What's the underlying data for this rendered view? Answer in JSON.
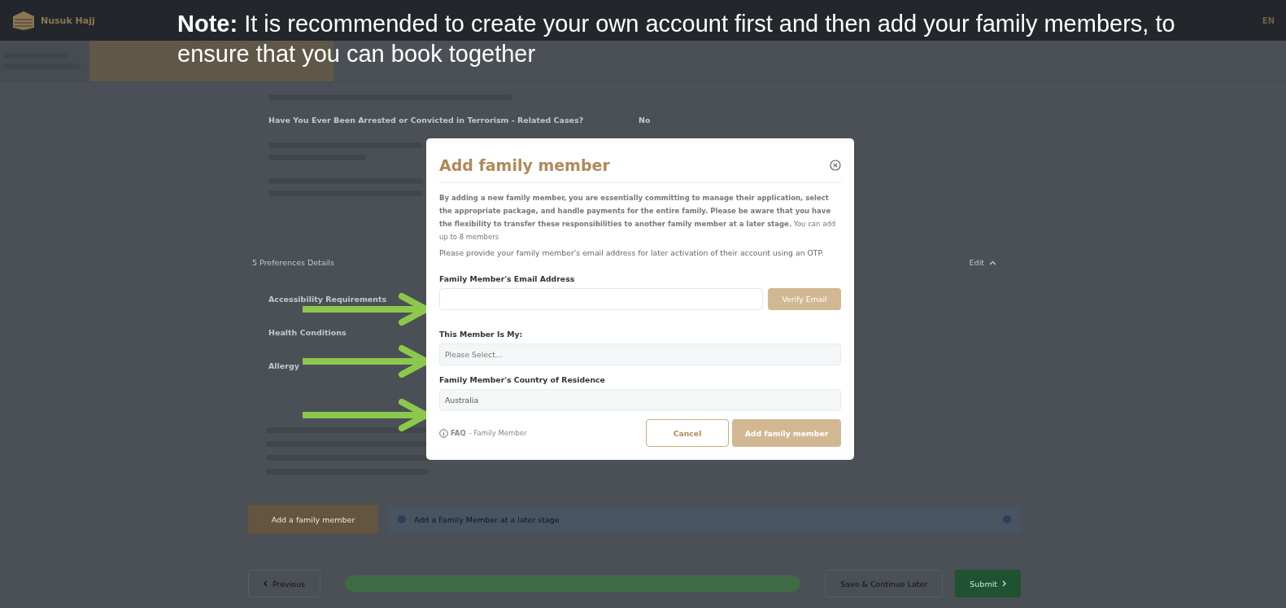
{
  "header": {
    "brand": "Nusuk Hajj",
    "language": "EN"
  },
  "note": "**Note:** It is recommended to create your own account first and then add your family members, to ensure that you can book together",
  "questions": [
    {
      "text": "Have You Ever Been Arrested or Convicted in Terrorism - Related Cases?",
      "answer": "No"
    }
  ],
  "section": {
    "title": "5 Preferences Details",
    "action": "Edit",
    "items": [
      "Accessibility Requirements",
      "Health Conditions",
      "Allergy"
    ]
  },
  "add_member_button": "Add a family member",
  "later_notice": "Add a Family Member at a later stage",
  "footer": {
    "previous": "Previous",
    "save": "Save & Continue Later",
    "submit": "Submit"
  },
  "dialog": {
    "title": "Add family member",
    "intro": "**By adding a new family member, you are essentially committing to manage their application, select the appropriate package, and handle payments for the entire family. Please be aware that you have the flexibility to transfer these responsibilities to another family member at a later stage.** You can add up to 8 members",
    "hint": "Please provide your family member's email address for later activation of their account using an OTP.",
    "email": {
      "label": "Family Member's Email Address",
      "button": "Verify Email"
    },
    "relation": {
      "label": "This Member Is My:",
      "placeholder": "Please Select..."
    },
    "country": {
      "label": "Family Member's Country of Residence",
      "value": "Australia"
    },
    "faq": "**FAQ** - Family Member",
    "cancel": "Cancel",
    "submit": "Add family member"
  }
}
